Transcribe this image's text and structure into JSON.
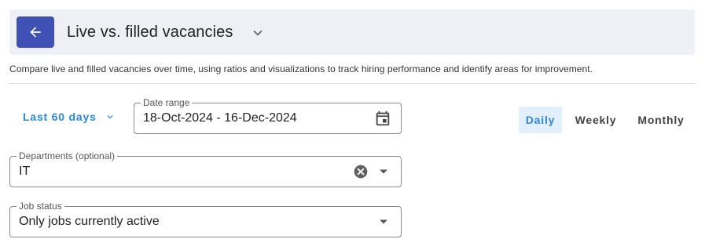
{
  "header": {
    "title": "Live vs. filled vacancies",
    "back_icon": "arrow-left-icon",
    "menu_icon": "chevron-down-icon"
  },
  "description": "Compare live and filled vacancies over time, using ratios and visualizations to track hiring performance and identify areas for improvement.",
  "filters": {
    "period_label": "Last 60 days",
    "date_range": {
      "label": "Date range",
      "value": "18-Oct-2024 - 16-Dec-2024"
    },
    "departments": {
      "label": "Departments (optional)",
      "value": "IT"
    },
    "job_status": {
      "label": "Job status",
      "value": "Only jobs currently active"
    }
  },
  "granularity": {
    "options": [
      "Daily",
      "Weekly",
      "Monthly"
    ],
    "selected": "Daily"
  },
  "colors": {
    "accent": "#3f51b5",
    "link": "#2f86d9",
    "header_bg": "#eef0f6",
    "selected_bg": "#e3f0fc"
  }
}
